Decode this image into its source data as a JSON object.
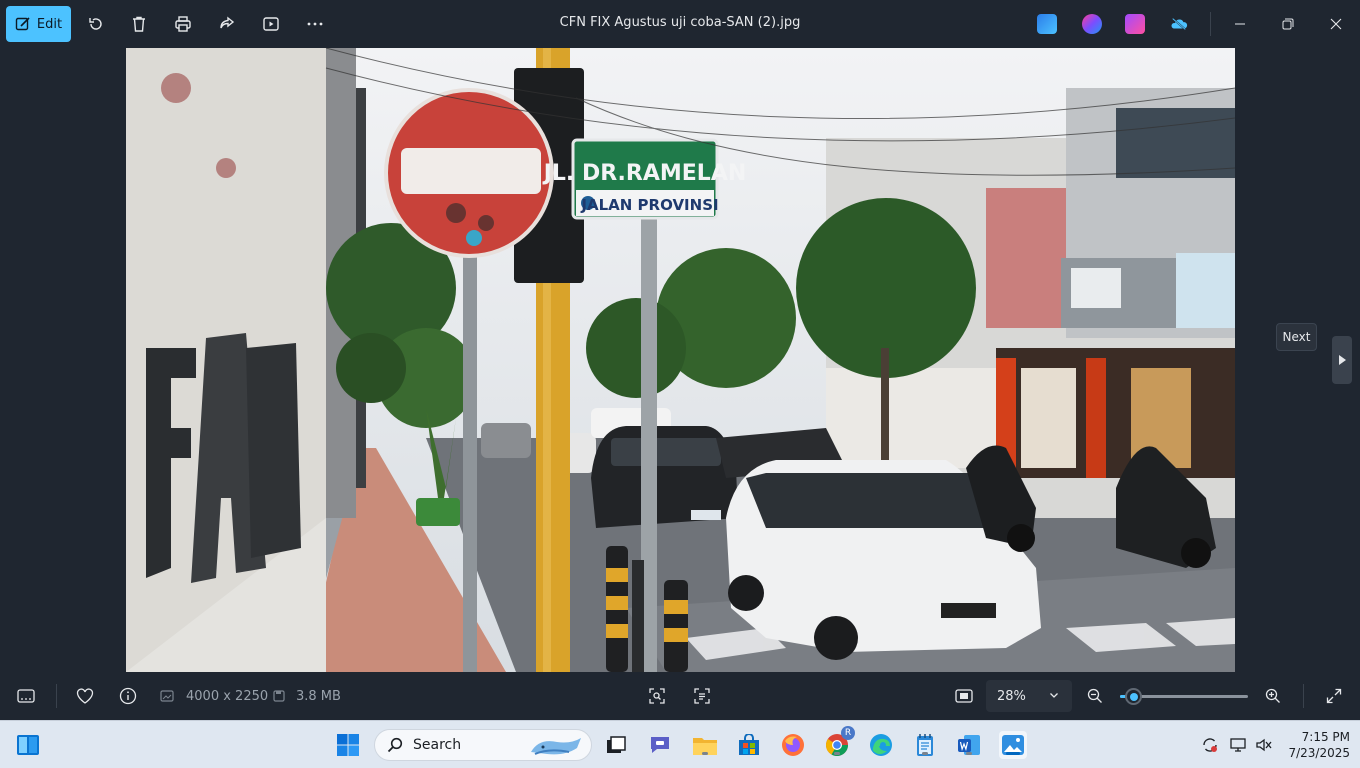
{
  "titlebar": {
    "edit_label": "Edit",
    "file_name": "CFN FIX Agustus uji coba-SAN (2).jpg",
    "tools": [
      "rotate-icon",
      "delete-icon",
      "print-icon",
      "share-icon",
      "slideshow-icon",
      "more-icon"
    ],
    "apps": [
      "designer-icon",
      "clipchamp-icon",
      "video-editor-icon",
      "onedrive-icon"
    ]
  },
  "photo": {
    "sign_street": "JL. DR.RAMELAN",
    "sign_sub": "JALAN PROVINSI"
  },
  "navigation": {
    "next_tooltip": "Next"
  },
  "bottombar": {
    "dimensions": "4000 x 2250",
    "file_size": "3.8 MB",
    "zoom": "28%",
    "zoom_level": 0.1
  },
  "taskbar": {
    "search_placeholder": "Search",
    "time": "7:15 PM",
    "date": "7/23/2025",
    "chrome_badge": "R"
  }
}
